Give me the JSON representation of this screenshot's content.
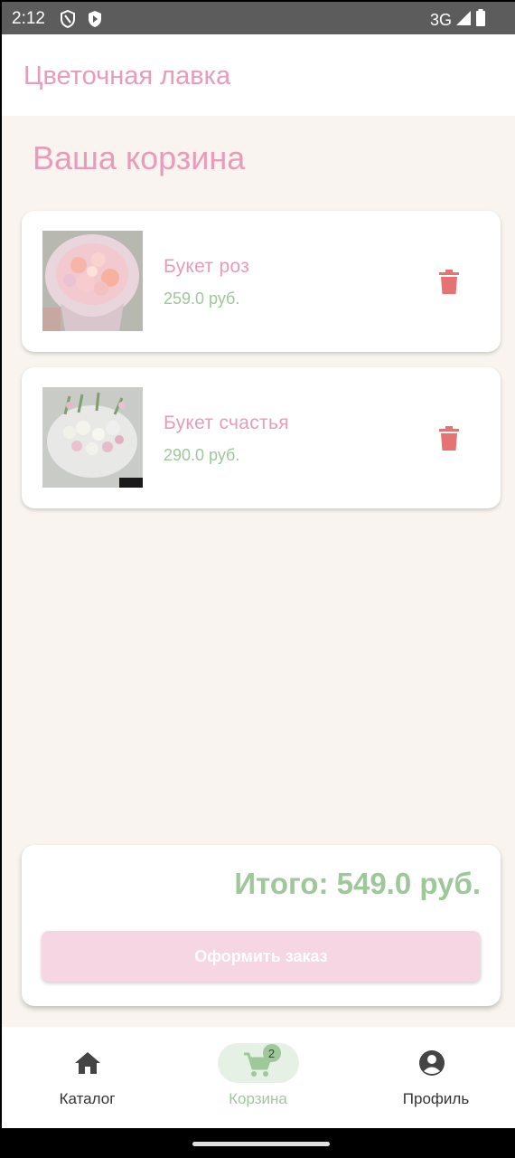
{
  "status_bar": {
    "time": "2:12",
    "network": "3G",
    "icons": [
      "shield-icon",
      "play-protect-icon",
      "signal-icon",
      "battery-icon"
    ]
  },
  "app_bar": {
    "title": "Цветочная лавка"
  },
  "page": {
    "title": "Ваша корзина"
  },
  "cart": {
    "items": [
      {
        "name": "Букет роз",
        "price": "259.0 руб.",
        "image": "bouquet-roses-photo"
      },
      {
        "name": "Букет счастья",
        "price": "290.0 руб.",
        "image": "bouquet-happiness-photo"
      }
    ],
    "total": "Итого: 549.0 руб.",
    "checkout_label": "Оформить заказ"
  },
  "bottom_nav": {
    "items": [
      {
        "label": "Каталог",
        "icon": "home-icon",
        "active": false
      },
      {
        "label": "Корзина",
        "icon": "cart-icon",
        "active": true,
        "badge": "2"
      },
      {
        "label": "Профиль",
        "icon": "account-icon",
        "active": false
      }
    ]
  },
  "colors": {
    "accent_pink": "#e89bbb",
    "accent_green": "#9ec89a",
    "delete_red": "#e57373",
    "background": "#f9f4ef",
    "button_disabled": "#f7d6e3"
  }
}
